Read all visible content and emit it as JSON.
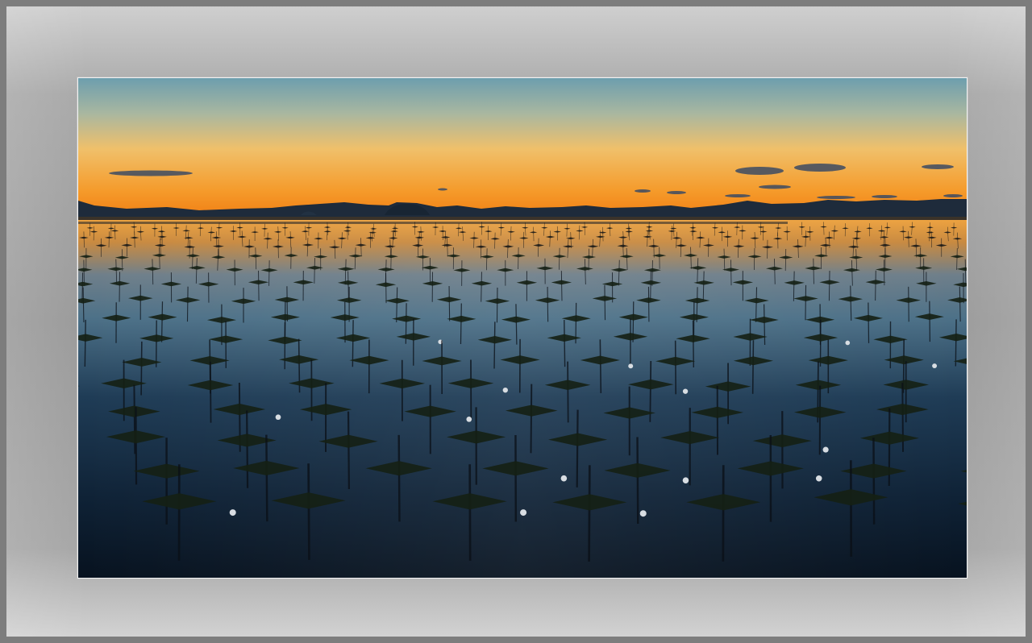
{
  "image": {
    "subject": "sunset-over-seaweed-farm",
    "colors": {
      "sky_top": "#6f9fb0",
      "sky_mid": "#f2b64a",
      "sky_horizon": "#f58a1a",
      "water_reflection": "#e7a23f",
      "water_deep": "#0d1c2c",
      "mountains": "#1d2a3a",
      "frame": "#a6a6a6"
    }
  }
}
